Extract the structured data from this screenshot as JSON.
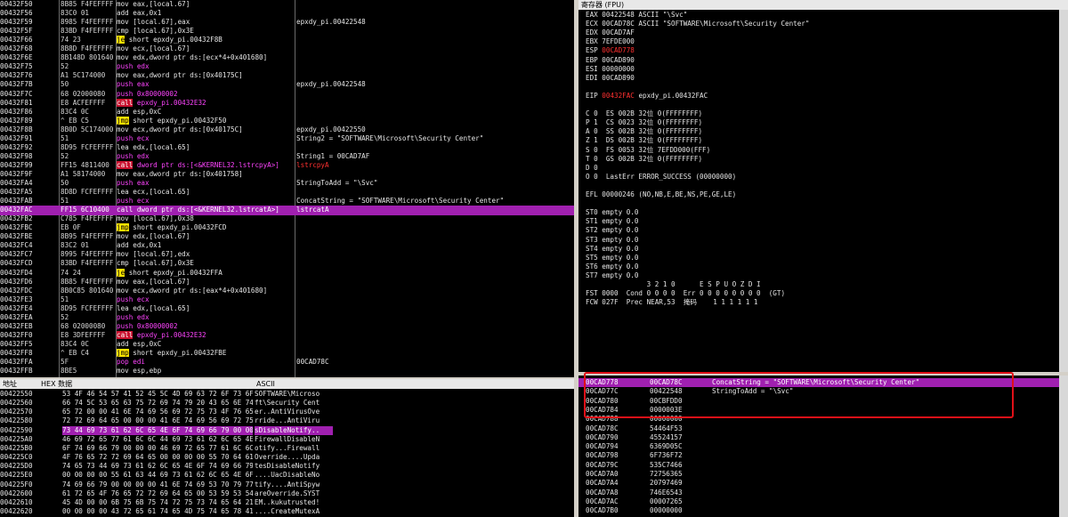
{
  "cpu": {
    "rows": [
      {
        "addr": "00432F50",
        "bytes": "8B85 F4FEFFFF",
        "disasm": "mov eax,[local.67]",
        "cmt": ""
      },
      {
        "addr": "00432F56",
        "bytes": "83C0 01",
        "disasm": "add eax,0x1",
        "cmt": ""
      },
      {
        "addr": "00432F59",
        "bytes": "8985 F4FEFFFF",
        "disasm": "mov [local.67],eax",
        "cmt": "epxdy_pi.00422548"
      },
      {
        "addr": "00432F5F",
        "bytes": "83BD F4FEFFFF",
        "disasm": "cmp [local.67],0x3E",
        "cmt": ""
      },
      {
        "addr": "00432F66",
        "bytes": "74 23",
        "disasm": "je short epxdy_pi.00432F8B",
        "cmt": "",
        "tag": "jmp",
        "tagw": "je"
      },
      {
        "addr": "00432F68",
        "bytes": "8B8D F4FEFFFF",
        "disasm": "mov ecx,[local.67]",
        "cmt": ""
      },
      {
        "addr": "00432F6E",
        "bytes": "8B148D 801640",
        "disasm": "mov edx,dword ptr ds:[ecx*4+0x401680]",
        "cmt": ""
      },
      {
        "addr": "00432F75",
        "bytes": "52",
        "disasm": "push edx",
        "cmt": "",
        "tag": "push"
      },
      {
        "addr": "00432F76",
        "bytes": "A1 5C174000",
        "disasm": "mov eax,dword ptr ds:[0x40175C]",
        "cmt": ""
      },
      {
        "addr": "00432F7B",
        "bytes": "50",
        "disasm": "push eax",
        "cmt": "epxdy_pi.00422548",
        "tag": "push"
      },
      {
        "addr": "00432F7C",
        "bytes": "68 02000080",
        "disasm": "push 0x80000002",
        "cmt": "",
        "tag": "push"
      },
      {
        "addr": "00432F81",
        "bytes": "E8 ACFEFFFF",
        "disasm": "call epxdy_pi.00432E32",
        "cmt": "",
        "tag": "call",
        "tagw": "call"
      },
      {
        "addr": "00432F86",
        "bytes": "83C4 0C",
        "disasm": "add esp,0xC",
        "cmt": ""
      },
      {
        "addr": "00432F89",
        "bytes": "^ EB C5",
        "disasm": "jmp short epxdy_pi.00432F50",
        "cmt": "",
        "tag": "jmp",
        "tagw": "jmp"
      },
      {
        "addr": "00432F8B",
        "bytes": "8B0D 5C174000",
        "disasm": "mov ecx,dword ptr ds:[0x40175C]",
        "cmt": "epxdy_pi.00422550"
      },
      {
        "addr": "00432F91",
        "bytes": "51",
        "disasm": "push ecx",
        "cmt": "String2 = \"SOFTWARE\\Microsoft\\Security Center\"",
        "tag": "push"
      },
      {
        "addr": "00432F92",
        "bytes": "8D95 FCFEFFFF",
        "disasm": "lea edx,[local.65]",
        "cmt": ""
      },
      {
        "addr": "00432F98",
        "bytes": "52",
        "disasm": "push edx",
        "cmt": "String1 = 00CAD7AF",
        "tag": "push"
      },
      {
        "addr": "00432F99",
        "bytes": "FF15 4811400",
        "disasm": "call dword ptr ds:[<&KERNEL32.lstrcpyA>]",
        "cmt": "lstrcpyA",
        "tag": "call",
        "tagw": "call",
        "cmtred": true
      },
      {
        "addr": "00432F9F",
        "bytes": "A1 58174000",
        "disasm": "mov eax,dword ptr ds:[0x401758]",
        "cmt": ""
      },
      {
        "addr": "00432FA4",
        "bytes": "50",
        "disasm": "push eax",
        "cmt": "StringToAdd = \"\\Svc\"",
        "tag": "push"
      },
      {
        "addr": "00432FA5",
        "bytes": "8D8D FCFEFFFF",
        "disasm": "lea ecx,[local.65]",
        "cmt": ""
      },
      {
        "addr": "00432FAB",
        "bytes": "51",
        "disasm": "push ecx",
        "cmt": "ConcatString = \"SOFTWARE\\Microsoft\\Security Center\"",
        "tag": "push"
      },
      {
        "addr": "00432FAC",
        "bytes": "FF15 6C10400",
        "disasm": "call dword ptr ds:[<&KERNEL32.lstrcatA>]",
        "cmt": "lstrcatA",
        "tag": "call",
        "tagw": "call",
        "sel": true
      },
      {
        "addr": "00432FB2",
        "bytes": "C785 F4FEFFFF",
        "disasm": "mov [local.67],0x38",
        "cmt": ""
      },
      {
        "addr": "00432FBC",
        "bytes": "EB 0F",
        "disasm": "jmp short epxdy_pi.00432FCD",
        "cmt": "",
        "tag": "jmp",
        "tagw": "jmp"
      },
      {
        "addr": "00432FBE",
        "bytes": "8B95 F4FEFFFF",
        "disasm": "mov edx,[local.67]",
        "cmt": ""
      },
      {
        "addr": "00432FC4",
        "bytes": "83C2 01",
        "disasm": "add edx,0x1",
        "cmt": ""
      },
      {
        "addr": "00432FC7",
        "bytes": "8995 F4FEFFFF",
        "disasm": "mov [local.67],edx",
        "cmt": ""
      },
      {
        "addr": "00432FCD",
        "bytes": "83BD F4FEFFFF",
        "disasm": "cmp [local.67],0x3E",
        "cmt": ""
      },
      {
        "addr": "00432FD4",
        "bytes": "74 24",
        "disasm": "je short epxdy_pi.00432FFA",
        "cmt": "",
        "tag": "jmp",
        "tagw": "je"
      },
      {
        "addr": "00432FD6",
        "bytes": "8B85 F4FEFFFF",
        "disasm": "mov eax,[local.67]",
        "cmt": ""
      },
      {
        "addr": "00432FDC",
        "bytes": "8B0C85 801640",
        "disasm": "mov ecx,dword ptr ds:[eax*4+0x401680]",
        "cmt": ""
      },
      {
        "addr": "00432FE3",
        "bytes": "51",
        "disasm": "push ecx",
        "cmt": "",
        "tag": "push"
      },
      {
        "addr": "00432FE4",
        "bytes": "8D95 FCFEFFFF",
        "disasm": "lea edx,[local.65]",
        "cmt": ""
      },
      {
        "addr": "00432FEA",
        "bytes": "52",
        "disasm": "push edx",
        "cmt": "",
        "tag": "push"
      },
      {
        "addr": "00432FEB",
        "bytes": "68 02000080",
        "disasm": "push 0x80000002",
        "cmt": "",
        "tag": "push"
      },
      {
        "addr": "00432FF0",
        "bytes": "E8 3DFEFFFF",
        "disasm": "call epxdy_pi.00432E32",
        "cmt": "",
        "tag": "call",
        "tagw": "call"
      },
      {
        "addr": "00432FF5",
        "bytes": "83C4 0C",
        "disasm": "add esp,0xC",
        "cmt": ""
      },
      {
        "addr": "00432FF8",
        "bytes": "^ EB C4",
        "disasm": "jmp short epxdy_pi.00432FBE",
        "cmt": "",
        "tag": "jmp",
        "tagw": "jmp"
      },
      {
        "addr": "00432FFA",
        "bytes": "5F",
        "disasm": "pop edi",
        "cmt": "00CAD78C",
        "tag": "push"
      },
      {
        "addr": "00432FFB",
        "bytes": "8BE5",
        "disasm": "mov esp,ebp",
        "cmt": ""
      }
    ]
  },
  "registers": {
    "title": "寄存器 (FPU)",
    "lines": [
      "EAX 00422548 ASCII \"\\Svc\"",
      "ECX 00CAD78C ASCII \"SOFTWARE\\Microsoft\\Security Center\"",
      "EDX 00CAD7AF",
      "EBX 7EFDE000",
      "ESP 00CAD778",
      "EBP 00CAD890",
      "ESI 00000000",
      "EDI 00CAD890",
      "",
      "EIP 00432FAC epxdy_pi.00432FAC",
      "",
      "C 0  ES 002B 32位 0(FFFFFFFF)",
      "P 1  CS 0023 32位 0(FFFFFFFF)",
      "A 0  SS 002B 32位 0(FFFFFFFF)",
      "Z 1  DS 002B 32位 0(FFFFFFFF)",
      "S 0  FS 0053 32位 7EFDD000(FFF)",
      "T 0  GS 002B 32位 0(FFFFFFFF)",
      "D 0",
      "O 0  LastErr ERROR_SUCCESS (00000000)",
      "",
      "EFL 00000246 (NO,NB,E,BE,NS,PE,GE,LE)",
      "",
      "ST0 empty 0.0",
      "ST1 empty 0.0",
      "ST2 empty 0.0",
      "ST3 empty 0.0",
      "ST4 empty 0.0",
      "ST5 empty 0.0",
      "ST6 empty 0.0",
      "ST7 empty 0.0",
      "               3 2 1 0      E S P U O Z D I",
      "FST 0000  Cond 0 0 0 0  Err 0 0 0 0 0 0 0 0  (GT)",
      "FCW 027F  Prec NEAR,53  掩码    1 1 1 1 1 1"
    ]
  },
  "dump": {
    "header": {
      "addr": "地址",
      "hex": "HEX 数据",
      "ascii": "ASCII"
    },
    "rows": [
      {
        "addr": "00422550",
        "hex": "53 4F 46 54 57 41 52 45 5C 4D 69 63 72 6F 73 6F",
        "asc": "SOFTWARE\\Microso"
      },
      {
        "addr": "00422560",
        "hex": "66 74 5C 53 65 63 75 72 69 74 79 20 43 65 6E 74",
        "asc": "ft\\Security Cent"
      },
      {
        "addr": "00422570",
        "hex": "65 72 00 00 41 6E 74 69 56 69 72 75 73 4F 76 65",
        "asc": "er..AntiVirusOve"
      },
      {
        "addr": "00422580",
        "hex": "72 72 69 64 65 00 00 00 41 6E 74 69 56 69 72 75",
        "asc": "rride...AntiViru"
      },
      {
        "addr": "00422590",
        "hex": "73 44 69 73 61 62 6C 65 4E 6F 74 69 66 79 00 00",
        "asc": "sDisableNotify..",
        "sel": true
      },
      {
        "addr": "004225A0",
        "hex": "46 69 72 65 77 61 6C 6C 44 69 73 61 62 6C 65 4E",
        "asc": "FirewallDisableN"
      },
      {
        "addr": "004225B0",
        "hex": "6F 74 69 66 79 00 00 00 46 69 72 65 77 61 6C 6C",
        "asc": "otify...Firewall"
      },
      {
        "addr": "004225C0",
        "hex": "4F 76 65 72 72 69 64 65 00 00 00 00 55 70 64 61",
        "asc": "Override....Upda"
      },
      {
        "addr": "004225D0",
        "hex": "74 65 73 44 69 73 61 62 6C 65 4E 6F 74 69 66 79",
        "asc": "tesDisableNotify"
      },
      {
        "addr": "004225E0",
        "hex": "00 00 00 00 55 61 63 44 69 73 61 62 6C 65 4E 6F",
        "asc": "....UacDisableNo"
      },
      {
        "addr": "004225F0",
        "hex": "74 69 66 79 00 00 00 00 41 6E 74 69 53 70 79 77",
        "asc": "tify....AntiSpyw"
      },
      {
        "addr": "00422600",
        "hex": "61 72 65 4F 76 65 72 72 69 64 65 00 53 59 53 54",
        "asc": "areOverride.SYST"
      },
      {
        "addr": "00422610",
        "hex": "45 4D 00 00 6B 75 6B 75 74 72 75 73 74 65 64 21",
        "asc": "EM..kukutrusted!"
      },
      {
        "addr": "00422620",
        "hex": "00 00 00 00 43 72 65 61 74 65 4D 75 74 65 78 41",
        "asc": "....CreateMutexA"
      }
    ]
  },
  "stack": {
    "rows": [
      {
        "addr": "00CAD778",
        "val": "00CAD78C",
        "cmt": "ConcatString = \"SOFTWARE\\Microsoft\\Security Center\"",
        "sel": true
      },
      {
        "addr": "00CAD77C",
        "val": "00422548",
        "cmt": "StringToAdd = \"\\Svc\""
      },
      {
        "addr": "00CAD780",
        "val": "00CBFDD0",
        "cmt": ""
      },
      {
        "addr": "00CAD784",
        "val": "0000003E",
        "cmt": ""
      },
      {
        "addr": "00CAD788",
        "val": "00000000",
        "cmt": ""
      },
      {
        "addr": "00CAD78C",
        "val": "54464F53",
        "cmt": ""
      },
      {
        "addr": "00CAD790",
        "val": "45524157",
        "cmt": ""
      },
      {
        "addr": "00CAD794",
        "val": "6369D05C",
        "cmt": ""
      },
      {
        "addr": "00CAD798",
        "val": "6F736F72",
        "cmt": ""
      },
      {
        "addr": "00CAD79C",
        "val": "535C7466",
        "cmt": ""
      },
      {
        "addr": "00CAD7A0",
        "val": "72756365",
        "cmt": ""
      },
      {
        "addr": "00CAD7A4",
        "val": "20797469",
        "cmt": ""
      },
      {
        "addr": "00CAD7A8",
        "val": "746E6543",
        "cmt": ""
      },
      {
        "addr": "00CAD7AC",
        "val": "00007265",
        "cmt": ""
      },
      {
        "addr": "00CAD7B0",
        "val": "00000000",
        "cmt": ""
      }
    ]
  },
  "colors": {
    "selection": "#a020b0",
    "call": "#c8102e",
    "jump": "#ffe400",
    "push": "#ff44ff",
    "changed": "#ff3030",
    "annotation": "#e01018"
  }
}
